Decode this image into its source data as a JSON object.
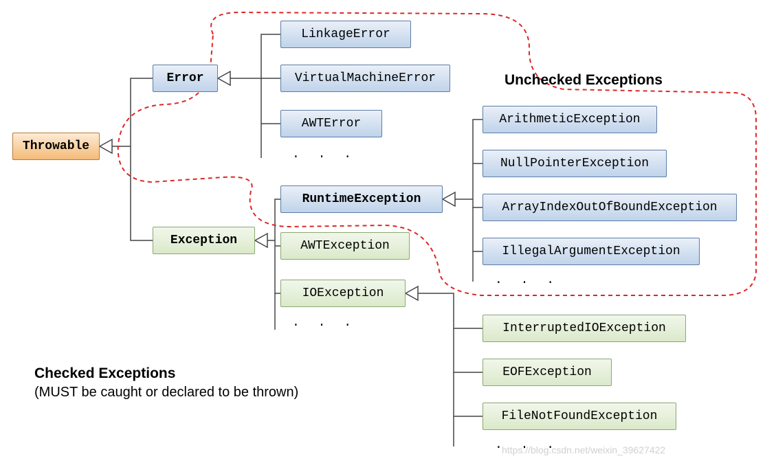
{
  "root": "Throwable",
  "error": {
    "name": "Error",
    "children": [
      "LinkageError",
      "VirtualMachineError",
      "AWTError"
    ]
  },
  "exception": {
    "name": "Exception",
    "runtime": {
      "name": "RuntimeException",
      "children": [
        "ArithmeticException",
        "NullPointerException",
        "ArrayIndexOutOfBoundException",
        "IllegalArgumentException"
      ]
    },
    "awt": "AWTException",
    "io": {
      "name": "IOException",
      "children": [
        "InterruptedIOException",
        "EOFException",
        "FileNotFoundException"
      ]
    }
  },
  "uncheckedLabel": "Unchecked Exceptions",
  "checkedLabel": "Checked Exceptions",
  "checkedSub": "(MUST be caught or declared to be thrown)",
  "ellipsis": ". . .",
  "watermark": "https://blog.csdn.net/weixin_39627422"
}
